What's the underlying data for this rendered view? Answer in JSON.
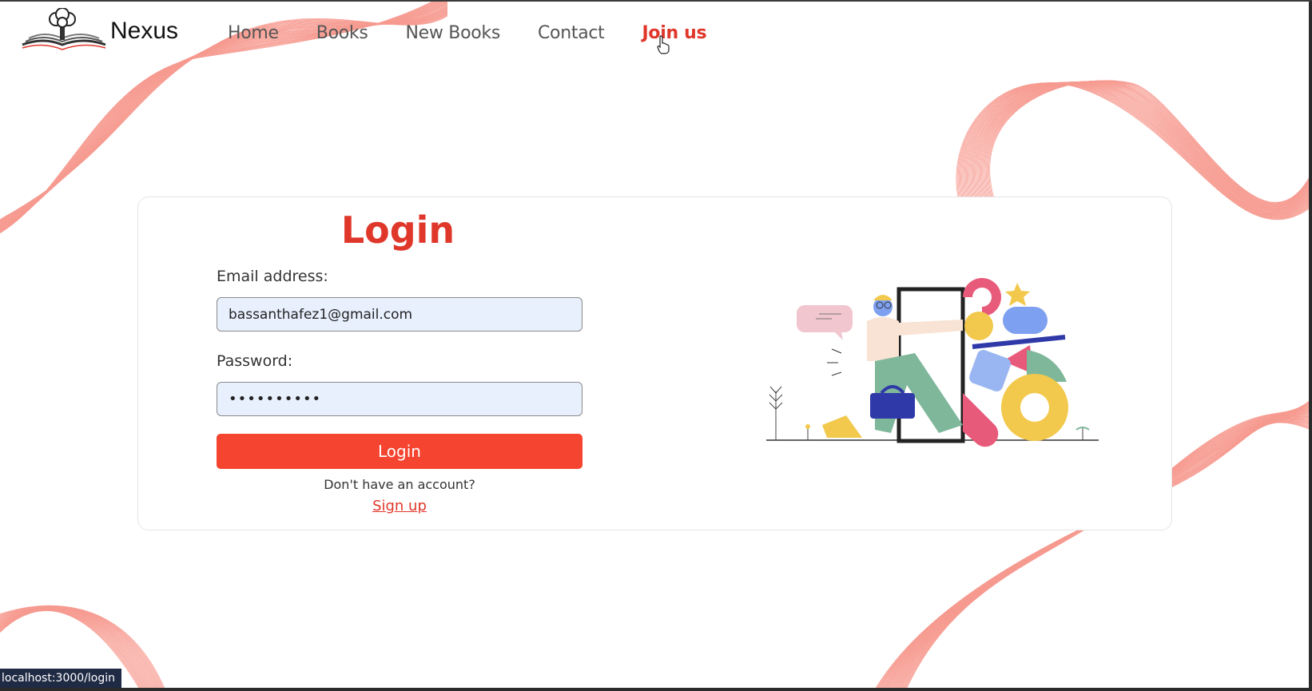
{
  "brand": {
    "name": "Nexus"
  },
  "nav": [
    {
      "label": "Home",
      "active": false
    },
    {
      "label": "Books",
      "active": false
    },
    {
      "label": "New Books",
      "active": false
    },
    {
      "label": "Contact",
      "active": false
    },
    {
      "label": "Join us",
      "active": true
    }
  ],
  "login": {
    "title": "Login",
    "email_label": "Email address:",
    "email_value": "bassanthafez1@gmail.com",
    "password_label": "Password:",
    "password_value": "••••••••••",
    "submit_label": "Login",
    "no_account_text": "Don't have an account?",
    "signup_link": "Sign up"
  },
  "status_bar": {
    "url": "localhost:3000/login"
  },
  "colors": {
    "accent": "#e0372b",
    "button": "#f5442f",
    "input_bg": "#e8f0fe",
    "wave": "#f47a6c"
  }
}
